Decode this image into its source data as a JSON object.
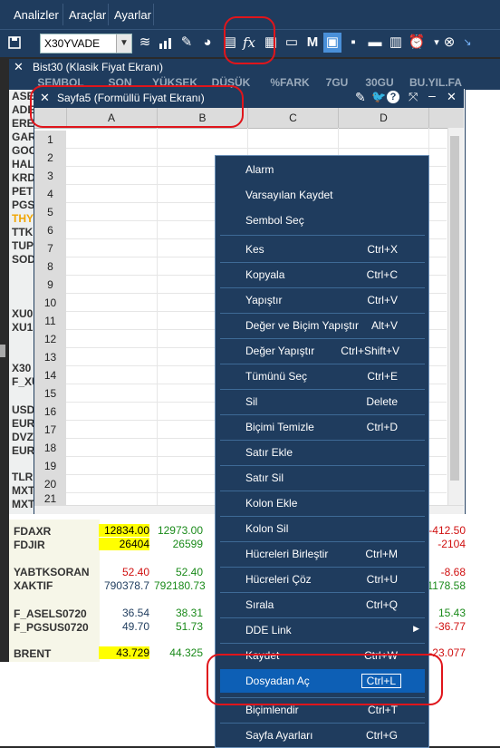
{
  "menubar": {
    "items": [
      "Analizler",
      "Araçlar",
      "Ayarlar"
    ]
  },
  "toolbar": {
    "symbol_value": "X30YVADE"
  },
  "bist_window": {
    "title": "Bist30 (Klasik Fiyat Ekranı)",
    "columns": [
      "SEMBOL",
      "SON",
      "YÜKSEK",
      "DÜŞÜK",
      "%FARK",
      "7GU",
      "30GU",
      "BU.YIL.FA"
    ],
    "left_symbols": [
      "ASE",
      "ADE",
      "ERE",
      "GAR",
      "GOO",
      "HAL",
      "KRD",
      "PETI",
      "PGS",
      "THY",
      "TTK",
      "TUP",
      "SOD",
      "XU0",
      "XU1",
      "X30",
      "F_XU",
      "USD",
      "EUR",
      "DVZ",
      "EUR",
      "TLRE",
      "MXT",
      "MXT"
    ]
  },
  "sayfa_window": {
    "title": "Sayfa5 (Formüllü Fiyat Ekranı)",
    "columns": [
      "A",
      "B",
      "C",
      "D"
    ],
    "rows": [
      "1",
      "2",
      "3",
      "4",
      "5",
      "6",
      "7",
      "8",
      "9",
      "10",
      "11",
      "12",
      "13",
      "14",
      "15",
      "16",
      "17",
      "18",
      "19",
      "20",
      "21"
    ]
  },
  "quotes": [
    {
      "symbol": "FDAXR",
      "v1": "12834.00",
      "v2": "12973.00",
      "v3": "-412.50"
    },
    {
      "symbol": "FDJIR",
      "v1": "26404",
      "v2": "26599",
      "v3": "-2104"
    },
    {
      "symbol": "YABTKSORAN",
      "v1": "52.40",
      "v2": "52.40",
      "v3": "-8.68"
    },
    {
      "symbol": "XAKTIF",
      "v1": "790378.7",
      "v2": "792180.73",
      "v3": "1178.58"
    },
    {
      "symbol": "F_ASELS0720",
      "v1": "36.54",
      "v2": "38.31",
      "v3": "15.43"
    },
    {
      "symbol": "F_PGSUS0720",
      "v1": "49.70",
      "v2": "51.73",
      "v3": "-36.77"
    },
    {
      "symbol": "BRENT",
      "v1": "43.729",
      "v2": "44.325",
      "v3": "-23.077"
    }
  ],
  "context_menu": {
    "items": [
      {
        "label": "Alarm",
        "shortcut": ""
      },
      {
        "label": "Varsayılan Kaydet",
        "shortcut": ""
      },
      {
        "label": "Sembol Seç",
        "shortcut": ""
      },
      {
        "label": "Kes",
        "shortcut": "Ctrl+X"
      },
      {
        "label": "Kopyala",
        "shortcut": "Ctrl+C"
      },
      {
        "label": "Yapıştır",
        "shortcut": "Ctrl+V"
      },
      {
        "label": "Değer ve Biçim Yapıştır",
        "shortcut": "Alt+V"
      },
      {
        "label": "Değer Yapıştır",
        "shortcut": "Ctrl+Shift+V"
      },
      {
        "label": "Tümünü Seç",
        "shortcut": "Ctrl+E"
      },
      {
        "label": "Sil",
        "shortcut": "Delete"
      },
      {
        "label": "Biçimi Temizle",
        "shortcut": "Ctrl+D"
      },
      {
        "label": "Satır Ekle",
        "shortcut": ""
      },
      {
        "label": "Satır Sil",
        "shortcut": ""
      },
      {
        "label": "Kolon Ekle",
        "shortcut": ""
      },
      {
        "label": "Kolon Sil",
        "shortcut": ""
      },
      {
        "label": "Hücreleri Birleştir",
        "shortcut": "Ctrl+M"
      },
      {
        "label": "Hücreleri Çöz",
        "shortcut": "Ctrl+U"
      },
      {
        "label": "Sırala",
        "shortcut": "Ctrl+Q"
      },
      {
        "label": "DDE Link",
        "shortcut": ""
      },
      {
        "label": "Kaydet",
        "shortcut": "Ctrl+W"
      },
      {
        "label": "Dosyadan Aç",
        "shortcut": "Ctrl+L"
      },
      {
        "label": "Biçimlendir",
        "shortcut": "Ctrl+T"
      },
      {
        "label": "Sayfa Ayarları",
        "shortcut": "Ctrl+G"
      }
    ]
  },
  "colors": {
    "menu_bg": "#1f3c5e",
    "highlight": "#0d5fb5",
    "annotation": "#e0151b",
    "yellow_cell": "#ffff00",
    "green_value": "#1a8a1a",
    "red_value": "#d01010"
  }
}
